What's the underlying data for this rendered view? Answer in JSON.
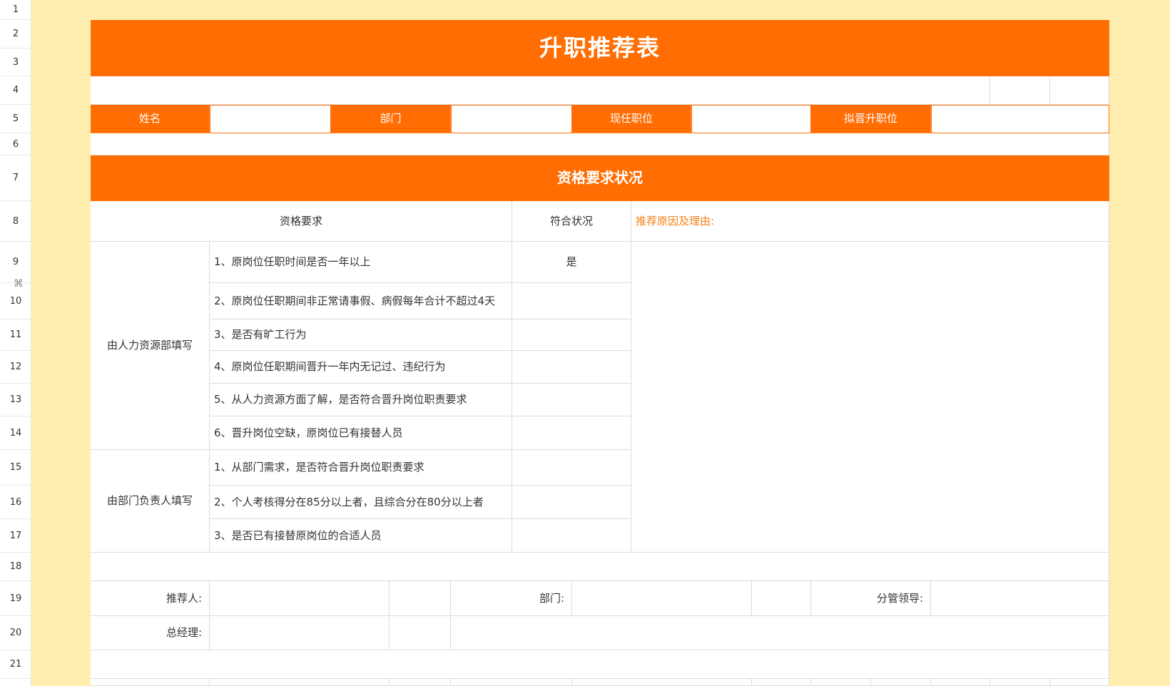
{
  "row_numbers": [
    "1",
    "2",
    "3",
    "4",
    "5",
    "6",
    "7",
    "8",
    "9",
    "10",
    "11",
    "12",
    "13",
    "14",
    "15",
    "16",
    "17",
    "18",
    "19",
    "20",
    "21"
  ],
  "drag_handle_glyph": "⌘",
  "colors": {
    "accent": "#ff6d03",
    "background": "#ffeeb0",
    "note_text": "#f57f17"
  },
  "title": "升职推荐表",
  "info_row": {
    "name_label": "姓名",
    "dept_label": "部门",
    "current_position_label": "现任职位",
    "proposed_position_label": "拟晋升职位"
  },
  "section_title": "资格要求状况",
  "table": {
    "col_requirement": "资格要求",
    "col_status": "符合状况",
    "col_reason": "推荐原因及理由:",
    "group_hr": "由人力资源部填写",
    "group_dept": "由部门负责人填写",
    "hr_items": [
      {
        "text": "1、原岗位任职时间是否一年以上",
        "status": "是"
      },
      {
        "text": "2、原岗位任职期间非正常请事假、病假每年合计不超过4天",
        "status": ""
      },
      {
        "text": "3、是否有旷工行为",
        "status": ""
      },
      {
        "text": "4、原岗位任职期间晋升一年内无记过、违纪行为",
        "status": ""
      },
      {
        "text": "5、从人力资源方面了解，是否符合晋升岗位职责要求",
        "status": ""
      },
      {
        "text": "6、晋升岗位空缺，原岗位已有接替人员",
        "status": ""
      }
    ],
    "dept_items": [
      {
        "text": "1、从部门需求，是否符合晋升岗位职责要求",
        "status": ""
      },
      {
        "text": "2、个人考核得分在85分以上者，且综合分在80分以上者",
        "status": ""
      },
      {
        "text": "3、是否已有接替原岗位的合适人员",
        "status": ""
      }
    ]
  },
  "signatures": {
    "recommender": "推荐人:",
    "department": "部门:",
    "supervisor": "分管领导:",
    "general_manager": "总经理:"
  }
}
